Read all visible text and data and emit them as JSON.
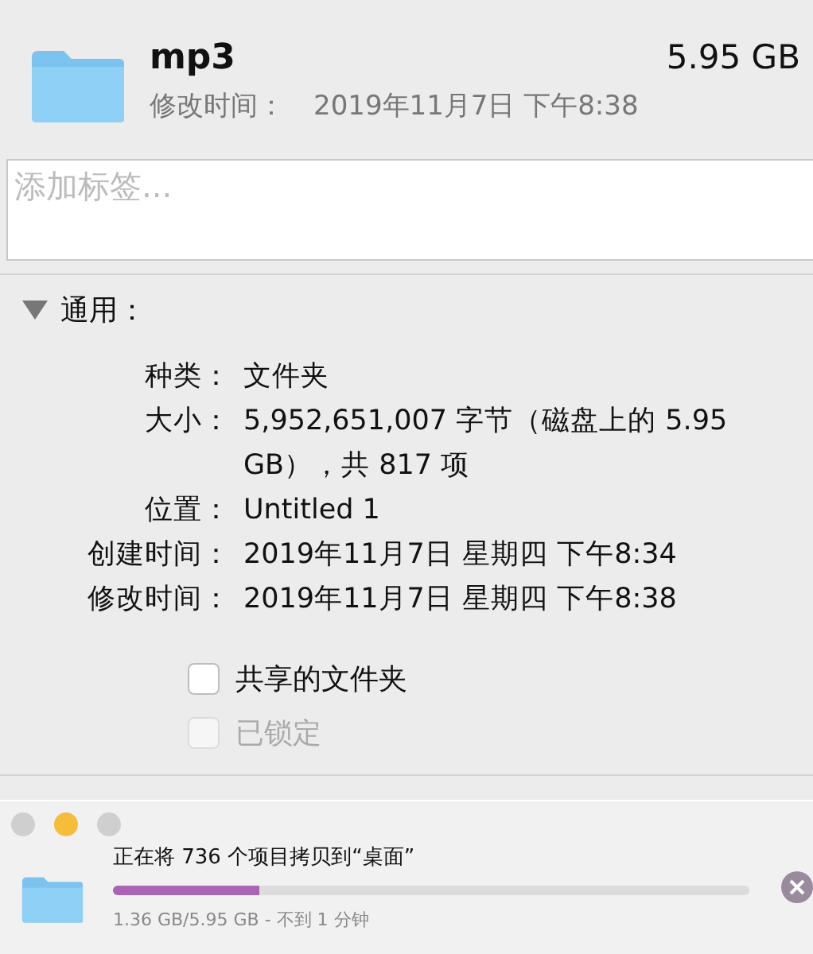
{
  "header": {
    "name": "mp3",
    "size": "5.95 GB",
    "modified_label": "修改时间：",
    "modified_value": "2019年11月7日 下午8:38"
  },
  "tags": {
    "placeholder": "添加标签..."
  },
  "general": {
    "title": "通用：",
    "expanded": true,
    "rows": [
      {
        "label": "种类：",
        "value": "文件夹"
      },
      {
        "label": "大小：",
        "value": "5,952,651,007 字节（磁盘上的 5.95 GB），共 817 项"
      },
      {
        "label": "位置：",
        "value": "Untitled 1"
      },
      {
        "label": "创建时间：",
        "value": "2019年11月7日 星期四 下午8:34"
      },
      {
        "label": "修改时间：",
        "value": "2019年11月7日 星期四 下午8:38"
      }
    ],
    "options": [
      {
        "label": "共享的文件夹",
        "checked": false,
        "disabled": false
      },
      {
        "label": "已锁定",
        "checked": false,
        "disabled": true
      }
    ]
  },
  "copy_panel": {
    "traffic_lights": [
      {
        "color": "#cfcfcf"
      },
      {
        "color": "#f5bd3a"
      },
      {
        "color": "#cfcfcf"
      }
    ],
    "message": "正在将 736 个项目拷贝到“桌面”",
    "level": 0.23,
    "status": "1.36 GB/5.95 GB - 不到 1 分钟"
  }
}
